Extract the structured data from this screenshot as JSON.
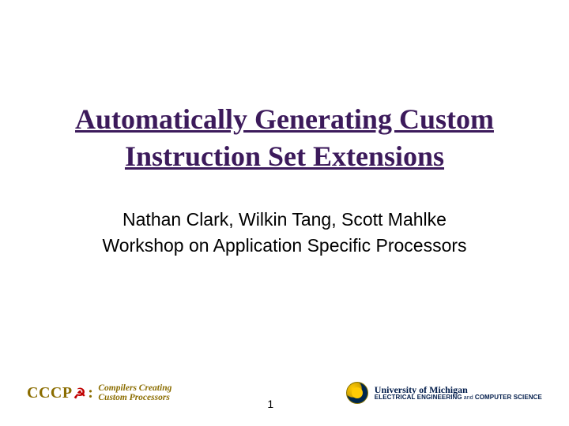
{
  "title": "Automatically Generating Custom Instruction Set Extensions",
  "authors_line1": "Nathan Clark, Wilkin Tang, Scott Mahlke",
  "authors_line2": "Workshop on Application Specific Processors",
  "page_number": "1",
  "footer": {
    "left": {
      "acronym": "CCC",
      "acronym_tail": "P",
      "subtitle_line1": "Compilers Creating",
      "subtitle_line2": "Custom Processors"
    },
    "right": {
      "line1": "University of Michigan",
      "line2_a": "ELECTRICAL ENGINEERING",
      "line2_and": " and ",
      "line2_b": "COMPUTER SCIENCE"
    }
  }
}
